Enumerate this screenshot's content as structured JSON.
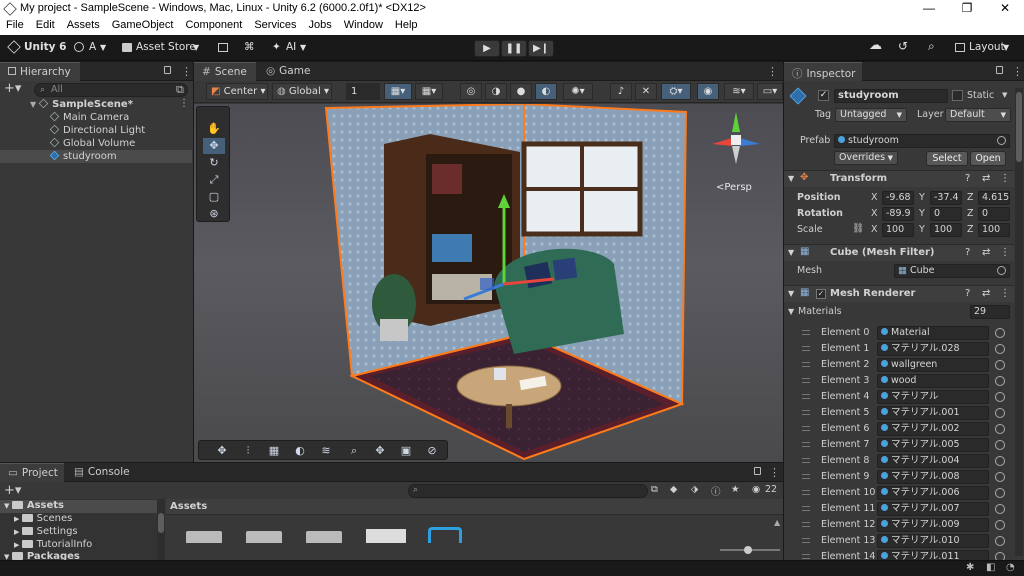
{
  "window": {
    "title": "My project - SampleScene - Windows, Mac, Linux - Unity 6.2 (6000.2.0f1)* <DX12>",
    "controls": [
      "—",
      "❐",
      "✕"
    ]
  },
  "menu": [
    "File",
    "Edit",
    "Assets",
    "GameObject",
    "Component",
    "Services",
    "Jobs",
    "Window",
    "Help"
  ],
  "toolbar": {
    "unity_label": "Unity 6",
    "account_label": "A",
    "asset_store_label": "Asset Store",
    "ai_label": "AI",
    "layout_label": "Layout"
  },
  "hierarchy": {
    "tab_label": "Hierarchy",
    "search_placeholder": "All",
    "scene_name": "SampleScene*",
    "items": [
      "Main Camera",
      "Directional Light",
      "Global Volume",
      "studyroom"
    ]
  },
  "scene_view": {
    "tabs": [
      "Scene",
      "Game"
    ],
    "pivot_label": "Center",
    "space_label": "Global",
    "grid_value": "1",
    "persp_label": "<Persp"
  },
  "inspector": {
    "tab_label": "Inspector",
    "object_name": "studyroom",
    "static_label": "Static",
    "tag_label": "Tag",
    "tag_value": "Untagged",
    "layer_label": "Layer",
    "layer_value": "Default",
    "prefab_label": "Prefab",
    "prefab_value": "studyroom",
    "overrides_label": "Overrides",
    "select_label": "Select",
    "open_label": "Open",
    "transform": {
      "title": "Transform",
      "position_label": "Position",
      "rotation_label": "Rotation",
      "scale_label": "Scale",
      "position": [
        "-9.68",
        "-37.4",
        "4.615"
      ],
      "rotation": [
        "-89.9",
        "0",
        "0"
      ],
      "scale": [
        "100",
        "100",
        "100"
      ]
    },
    "mesh_filter": {
      "title": "Cube (Mesh Filter)",
      "mesh_label": "Mesh",
      "mesh_value": "Cube"
    },
    "mesh_renderer": {
      "title": "Mesh Renderer",
      "materials_label": "Materials",
      "materials_count": "29",
      "elements": [
        {
          "label": "Element 0",
          "value": "Material"
        },
        {
          "label": "Element 1",
          "value": "マテリアル.028"
        },
        {
          "label": "Element 2",
          "value": "wallgreen"
        },
        {
          "label": "Element 3",
          "value": "wood"
        },
        {
          "label": "Element 4",
          "value": "マテリアル"
        },
        {
          "label": "Element 5",
          "value": "マテリアル.001"
        },
        {
          "label": "Element 6",
          "value": "マテリアル.002"
        },
        {
          "label": "Element 7",
          "value": "マテリアル.005"
        },
        {
          "label": "Element 8",
          "value": "マテリアル.004"
        },
        {
          "label": "Element 9",
          "value": "マテリアル.008"
        },
        {
          "label": "Element 10",
          "value": "マテリアル.006"
        },
        {
          "label": "Element 11",
          "value": "マテリアル.007"
        },
        {
          "label": "Element 12",
          "value": "マテリアル.009"
        },
        {
          "label": "Element 13",
          "value": "マテリアル.010"
        },
        {
          "label": "Element 14",
          "value": "マテリアル.011"
        }
      ]
    }
  },
  "project": {
    "tabs": [
      "Project",
      "Console"
    ],
    "tree": [
      "Assets",
      "Scenes",
      "Settings",
      "TutorialInfo",
      "Packages"
    ],
    "assets_header": "Assets",
    "hidden_count": "22"
  },
  "colors": {
    "accent_blue": "#4aa3df",
    "selection": "#2c5d87",
    "selected_outline": "#ff7a1a"
  }
}
